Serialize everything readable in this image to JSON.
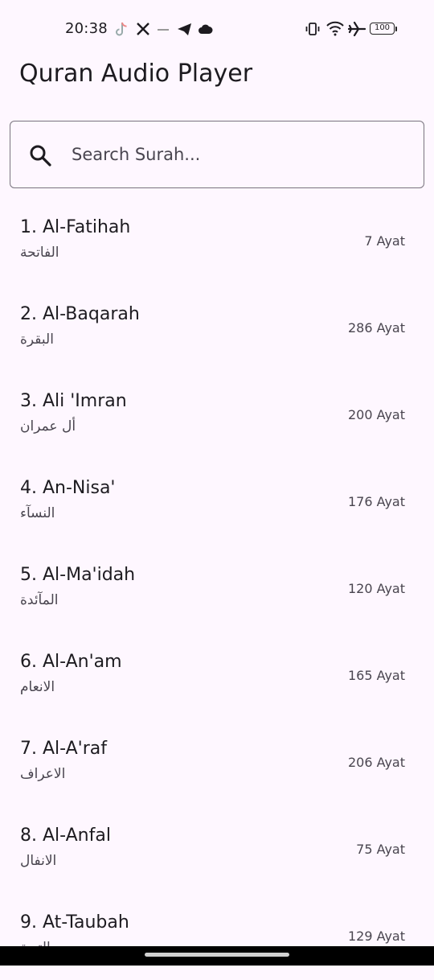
{
  "status_bar": {
    "time": "20:38",
    "battery": "100",
    "left_icons": [
      "tiktok-icon",
      "x-icon",
      "dots-icon",
      "telegram-icon",
      "cloud-icon"
    ],
    "right_icons": [
      "vibrate-icon",
      "wifi-icon",
      "airplane-icon",
      "battery-icon"
    ]
  },
  "app": {
    "title": "Quran Audio Player"
  },
  "search": {
    "placeholder": "Search Surah..."
  },
  "surahs": [
    {
      "name": "1. Al-Fatihah",
      "arabic": "الفاتحة",
      "ayat": "7 Ayat"
    },
    {
      "name": "2. Al-Baqarah",
      "arabic": "البقرة",
      "ayat": "286 Ayat"
    },
    {
      "name": "3. Ali 'Imran",
      "arabic": "أل عمران",
      "ayat": "200 Ayat"
    },
    {
      "name": "4. An-Nisa'",
      "arabic": "النسآء",
      "ayat": "176 Ayat"
    },
    {
      "name": "5. Al-Ma'idah",
      "arabic": "المآئدة",
      "ayat": "120 Ayat"
    },
    {
      "name": "6. Al-An'am",
      "arabic": "الانعام",
      "ayat": "165 Ayat"
    },
    {
      "name": "7. Al-A'raf",
      "arabic": "الاعراف",
      "ayat": "206 Ayat"
    },
    {
      "name": "8. Al-Anfal",
      "arabic": "الانفال",
      "ayat": "75 Ayat"
    },
    {
      "name": "9. At-Taubah",
      "arabic": "التوبة",
      "ayat": "129 Ayat"
    }
  ],
  "colors": {
    "background": "#fef7ff",
    "text_primary": "#1d1b20",
    "text_secondary": "#49454f",
    "outline": "#79747e"
  }
}
